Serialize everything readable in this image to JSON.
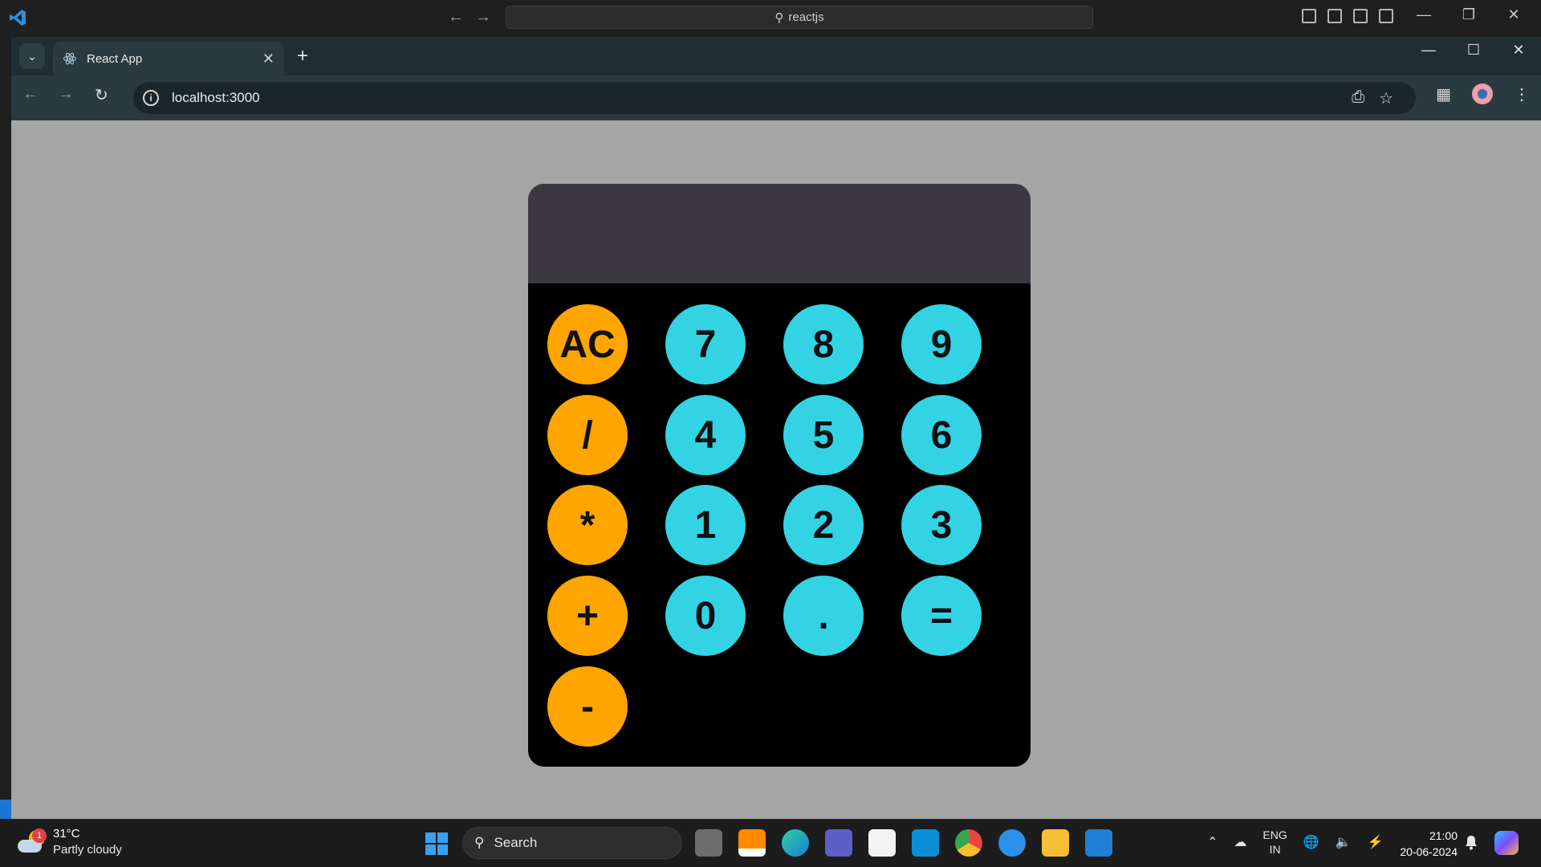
{
  "vscode": {
    "search_text": "reactjs"
  },
  "browser": {
    "tab_title": "React App",
    "url": "localhost:3000"
  },
  "calculator": {
    "display_value": "",
    "keys": [
      {
        "label": "AC",
        "type": "op"
      },
      {
        "label": "7",
        "type": "num"
      },
      {
        "label": "8",
        "type": "num"
      },
      {
        "label": "9",
        "type": "num"
      },
      {
        "label": "/",
        "type": "op"
      },
      {
        "label": "4",
        "type": "num"
      },
      {
        "label": "5",
        "type": "num"
      },
      {
        "label": "6",
        "type": "num"
      },
      {
        "label": "*",
        "type": "op"
      },
      {
        "label": "1",
        "type": "num"
      },
      {
        "label": "2",
        "type": "num"
      },
      {
        "label": "3",
        "type": "num"
      },
      {
        "label": "+",
        "type": "op"
      },
      {
        "label": "0",
        "type": "num"
      },
      {
        "label": ".",
        "type": "num"
      },
      {
        "label": "=",
        "type": "num"
      },
      {
        "label": "-",
        "type": "op"
      }
    ],
    "colors": {
      "operator": "#ffa500",
      "number": "#33d3e4",
      "display_bg": "#3c3840",
      "body": "#000000",
      "page_bg": "#a5a5a5"
    }
  },
  "taskbar": {
    "weather_temp": "31°C",
    "weather_condition": "Partly cloudy",
    "weather_badge": "1",
    "search_placeholder": "Search",
    "lang_line1": "ENG",
    "lang_line2": "IN",
    "time": "21:00",
    "date": "20-06-2024",
    "apps": [
      "task-view-icon",
      "vlc-icon",
      "edge-icon",
      "teams-icon",
      "store-icon",
      "myhp-icon",
      "chrome-icon",
      "get-help-icon",
      "file-explorer-icon",
      "vscode-icon"
    ]
  }
}
